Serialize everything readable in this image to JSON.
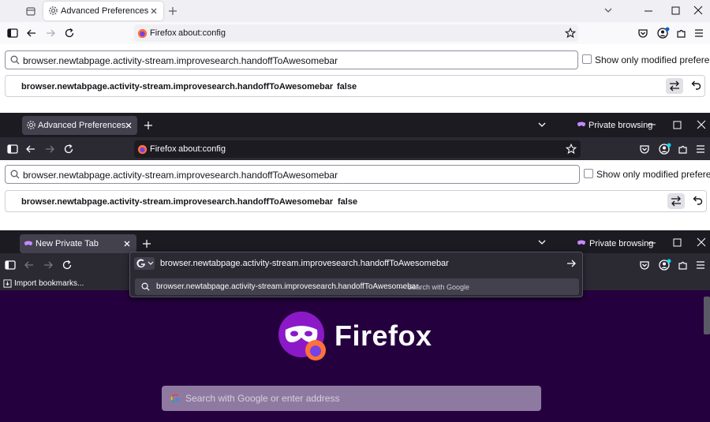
{
  "window1": {
    "tab_title": "Advanced Preferences",
    "identity_label": "Firefox",
    "url": "about:config",
    "search_value": "browser.newtabpage.activity-stream.improvesearch.handoffToAwesomebar",
    "show_modified_label": "Show only modified preferences",
    "pref_name": "browser.newtabpage.activity-stream.improvesearch.handoffToAwesomebar",
    "pref_value": "false"
  },
  "window2": {
    "tab_title": "Advanced Preferences",
    "private_label": "Private browsing",
    "identity_label": "Firefox",
    "url": "about:config",
    "search_value": "browser.newtabpage.activity-stream.improvesearch.handoffToAwesomebar",
    "show_modified_label": "Show only modified preferences",
    "pref_name": "browser.newtabpage.activity-stream.improvesearch.handoffToAwesomebar",
    "pref_value": "false"
  },
  "window3": {
    "tab_title": "New Private Tab",
    "private_label": "Private browsing",
    "urlbar_value": "browser.newtabpage.activity-stream.improvesearch.handoffToAwesomebar",
    "suggestion_text": "browser.newtabpage.activity-stream.improvesearch.handoffToAwesomebar",
    "suggestion_action": "— Search with Google",
    "bookmark_label": "Import bookmarks...",
    "brand_word": "Firefox",
    "search_placeholder": "Search with Google or enter address"
  },
  "colors": {
    "accent": "#0061e0",
    "private_purple": "#25003e",
    "dark_chrome": "#1c1b22"
  },
  "icons": [
    "tab-overview-icon",
    "gear-icon",
    "close-icon",
    "plus-icon",
    "chevron-down-icon",
    "minimize-icon",
    "maximize-icon",
    "sidebar-icon",
    "back-icon",
    "forward-icon",
    "reload-icon",
    "firefox-icon",
    "star-icon",
    "pocket-icon",
    "account-icon",
    "extensions-icon",
    "menu-icon",
    "search-icon",
    "toggle-icon",
    "reset-icon",
    "private-mask-icon",
    "google-icon",
    "arrow-right-icon",
    "import-icon"
  ]
}
